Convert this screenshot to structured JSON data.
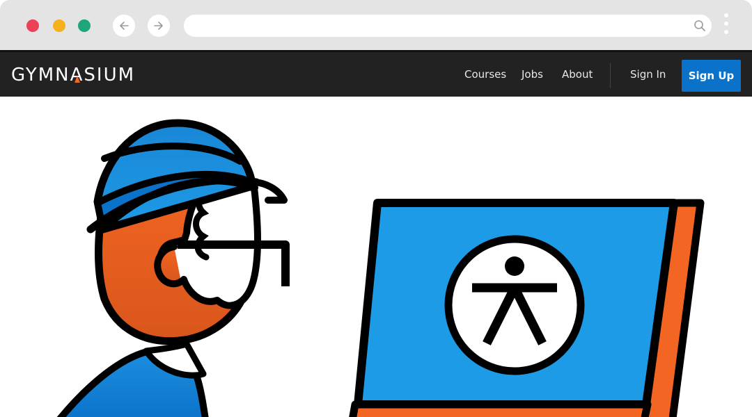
{
  "browser": {
    "url_value": "",
    "icons": {
      "back": "arrow-left-icon",
      "forward": "arrow-right-icon",
      "search": "search-icon",
      "menu": "kebab-menu-icon"
    },
    "traffic_light_colors": [
      "#ee4156",
      "#f5b11c",
      "#1ea57b"
    ]
  },
  "site": {
    "logo_prefix": "GYMN",
    "logo_mark": "A",
    "logo_suffix": "SIUM",
    "nav": {
      "courses": "Courses",
      "jobs": "Jobs",
      "about": "About",
      "sign_in": "Sign In",
      "sign_up": "Sign Up"
    }
  },
  "colors": {
    "nav_bg": "#222222",
    "accent_blue": "#0a72c9",
    "accent_orange": "#f26522",
    "screen_blue": "#1d9be6"
  },
  "hero": {
    "illustration": "person-wearing-beanie-looking-at-laptop-with-accessibility-icon"
  }
}
